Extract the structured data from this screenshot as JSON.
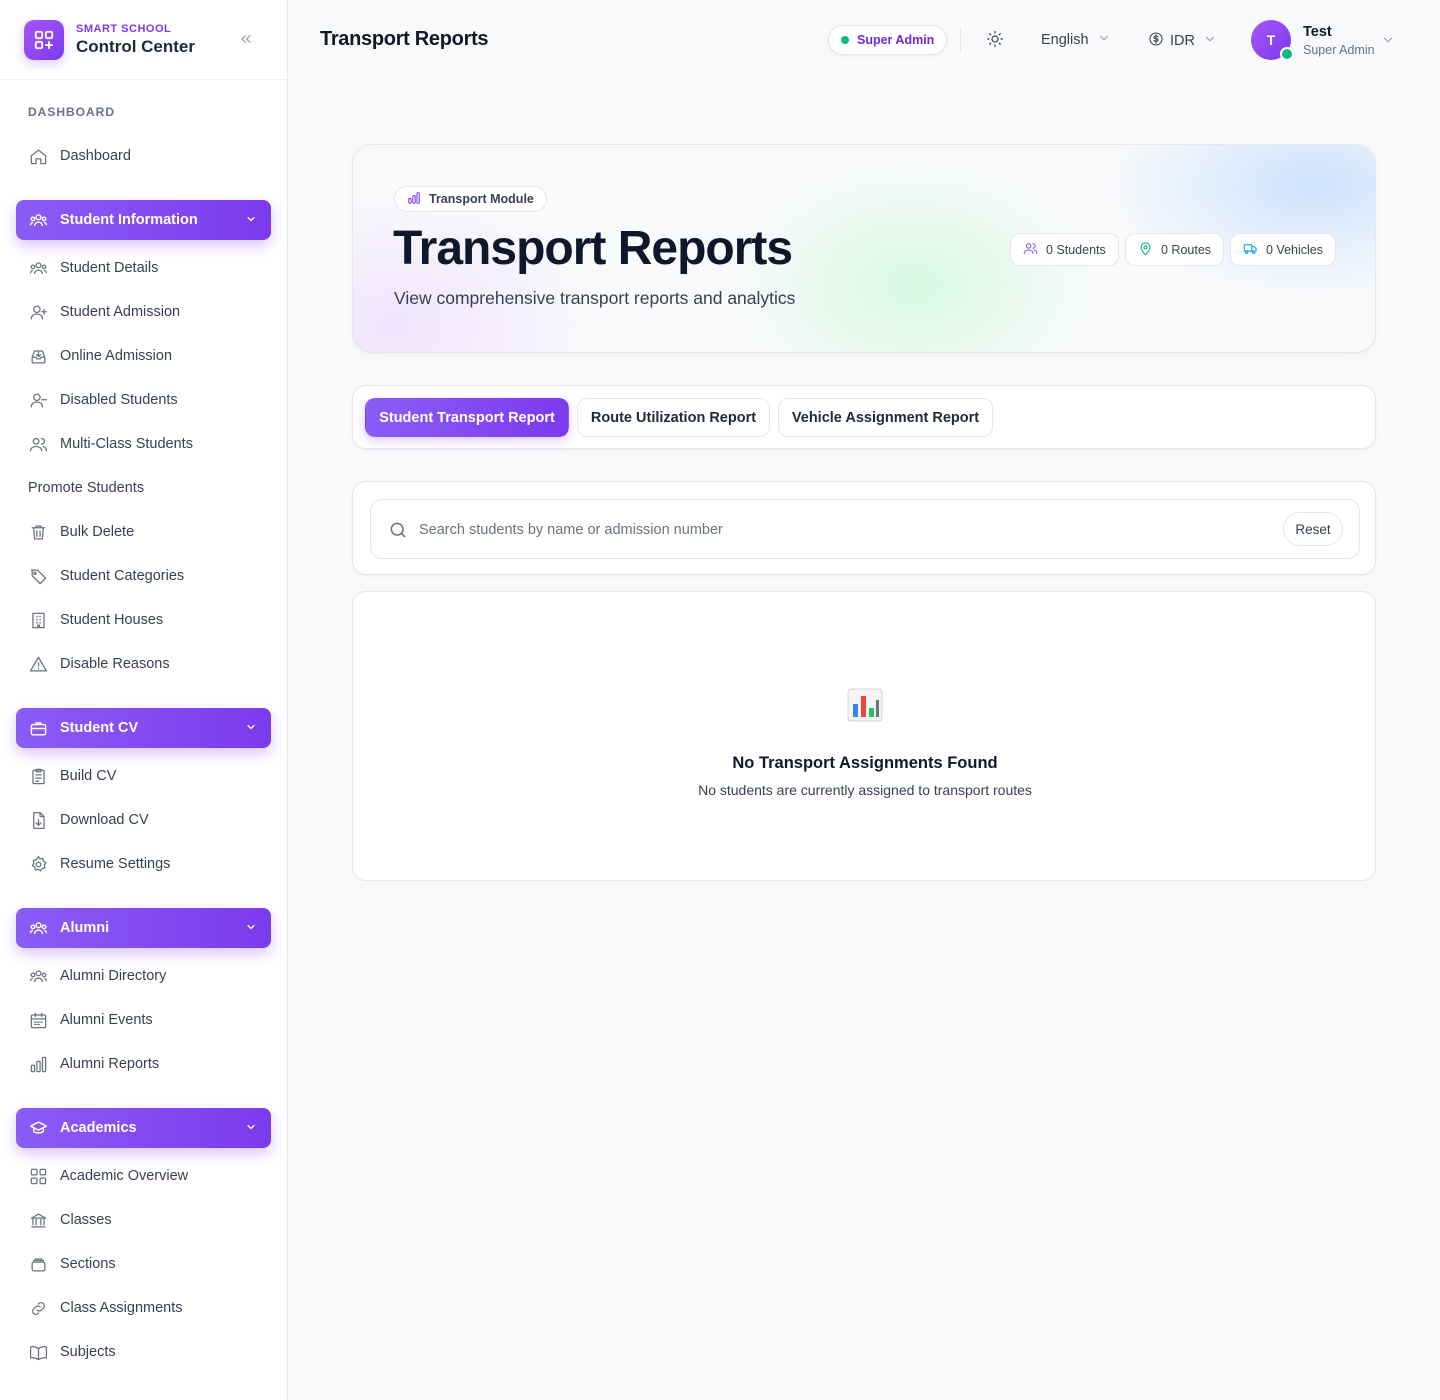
{
  "brand": {
    "small": "SMART SCHOOL",
    "big": "Control Center"
  },
  "sidebar": {
    "section_label": "DASHBOARD",
    "dashboard": "Dashboard",
    "groups": {
      "student_information": {
        "label": "Student Information",
        "items": [
          "Student Details",
          "Student Admission",
          "Online Admission",
          "Disabled Students",
          "Multi-Class Students",
          "Promote Students",
          "Bulk Delete",
          "Student Categories",
          "Student Houses",
          "Disable Reasons"
        ]
      },
      "student_cv": {
        "label": "Student CV",
        "items": [
          "Build CV",
          "Download CV",
          "Resume Settings"
        ]
      },
      "alumni": {
        "label": "Alumni",
        "items": [
          "Alumni Directory",
          "Alumni Events",
          "Alumni Reports"
        ]
      },
      "academics": {
        "label": "Academics",
        "items": [
          "Academic Overview",
          "Classes",
          "Sections",
          "Class Assignments",
          "Subjects"
        ]
      }
    }
  },
  "header": {
    "title": "Transport Reports",
    "role_badge": "Super Admin",
    "language": "English",
    "currency": "IDR",
    "user": {
      "initial": "T",
      "name": "Test",
      "role": "Super Admin"
    }
  },
  "hero": {
    "badge": "Transport Module",
    "title": "Transport Reports",
    "subtitle": "View comprehensive transport reports and analytics",
    "stats": {
      "students": "0 Students",
      "routes": "0 Routes",
      "vehicles": "0 Vehicles"
    }
  },
  "tabs": {
    "student_transport": "Student Transport Report",
    "route_utilization": "Route Utilization Report",
    "vehicle_assignment": "Vehicle Assignment Report"
  },
  "search": {
    "placeholder": "Search students by name or admission number",
    "value": "",
    "reset_label": "Reset"
  },
  "empty_state": {
    "icon": "bar-chart-emoji",
    "title": "No Transport Assignments Found",
    "subtitle": "No students are currently assigned to transport routes"
  },
  "colors": {
    "accent": "#7c3aed",
    "online": "#10b981"
  }
}
